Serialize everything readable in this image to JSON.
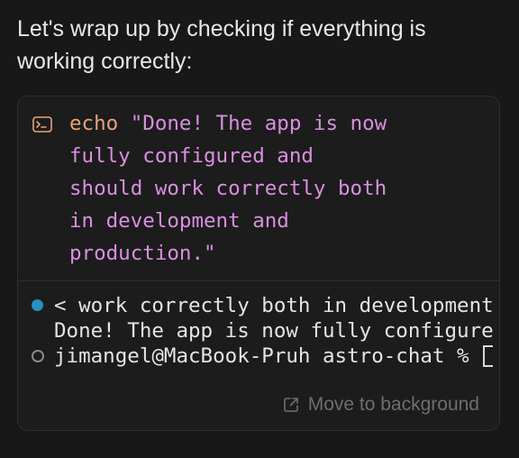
{
  "intro": {
    "text": "Let's wrap up by checking if everything is working correctly:"
  },
  "command": {
    "icon": "terminal-icon",
    "keyword": "echo",
    "argument": "\"Done! The app is now\nfully configured and\nshould work correctly both\nin development and\nproduction.\""
  },
  "output": {
    "line1": "< work correctly both in development",
    "line2": "Done! The app is now fully configure",
    "line3": "jimangel@MacBook-Pruh astro-chat % ",
    "status_running_color": "#2a8fbf"
  },
  "actions": {
    "move_to_background_label": "Move to background",
    "move_to_background_icon": "external-link-icon"
  }
}
